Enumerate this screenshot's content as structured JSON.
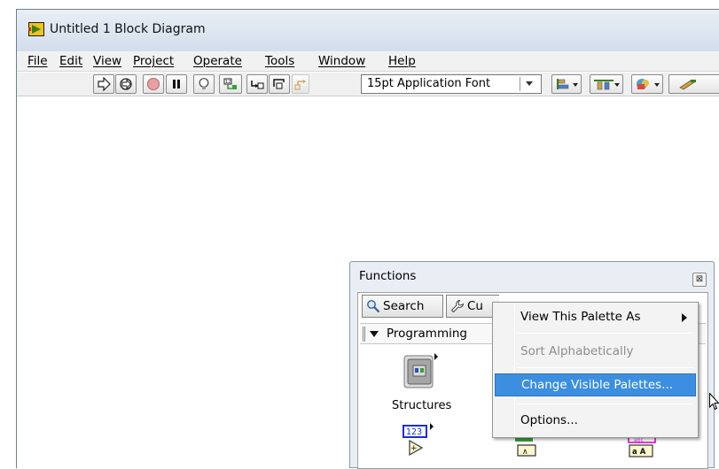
{
  "window": {
    "title": "Untitled 1 Block Diagram"
  },
  "menubar": {
    "items": [
      "File",
      "Edit",
      "View",
      "Project",
      "Operate",
      "Tools",
      "Window",
      "Help"
    ]
  },
  "toolbar": {
    "font_ring": "15pt Application Font",
    "buttons": [
      "run-arrow-icon",
      "run-continuously-icon",
      "abort-icon",
      "pause-icon",
      "highlight-execution-icon",
      "retain-wire-values-icon",
      "step-into-icon",
      "step-over-icon",
      "step-out-icon",
      "align-objects-icon",
      "distribute-objects-icon",
      "reorder-icon",
      "cleanup-diagram-icon"
    ]
  },
  "palette": {
    "title": "Functions",
    "search_tab": "Search",
    "customize_tab": "Cu",
    "category": "Programming",
    "structures_label": "Structures",
    "numeric_glyph": "123",
    "string_glyph": "abc",
    "string_sub_glyph": "a A"
  },
  "context_menu": {
    "items": [
      {
        "label": "View This Palette As",
        "state": "submenu"
      },
      {
        "label": "Sort Alphabetically",
        "state": "disabled"
      },
      {
        "label": "Change Visible Palettes...",
        "state": "highlighted"
      },
      {
        "label": "Options...",
        "state": "normal"
      }
    ]
  },
  "colors": {
    "titlebar_top": "#e9eef6",
    "titlebar_bottom": "#d3deec",
    "menu_highlight": "#3c8ee0",
    "disabled_text": "#8d8d8d",
    "numeric_blue": "#1a2fd6",
    "string_pink": "#e03ad6"
  }
}
